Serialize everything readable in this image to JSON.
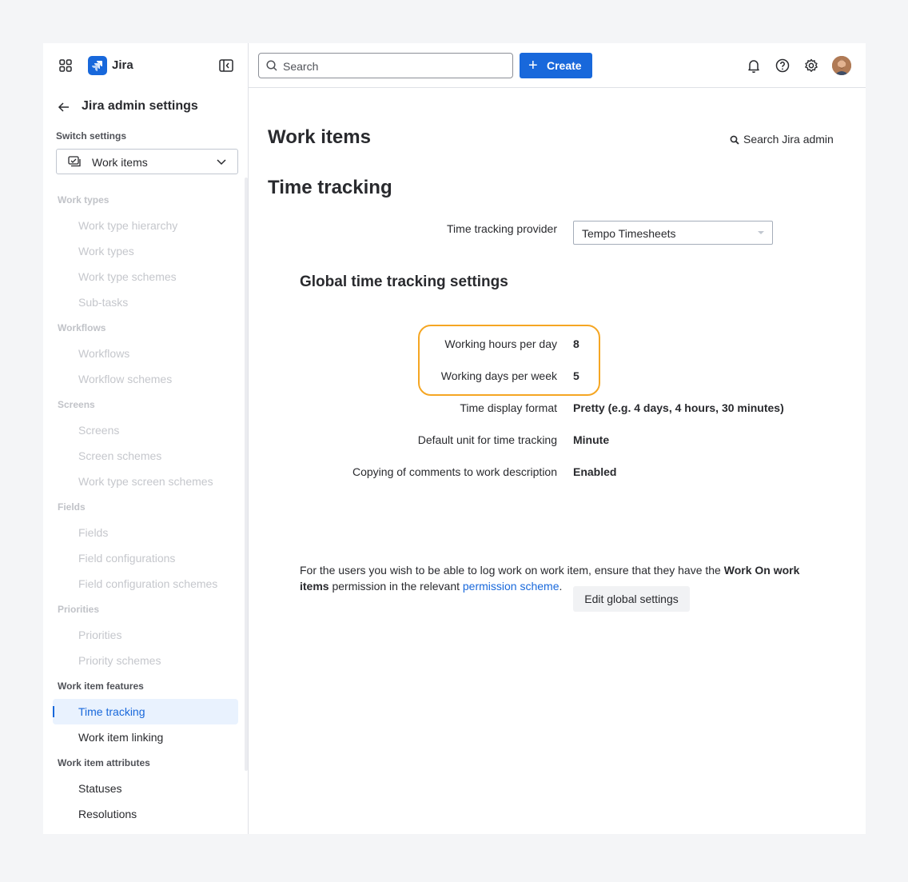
{
  "brand": {
    "app_name": "Jira",
    "logo_color": "#1868db"
  },
  "sidebar": {
    "back_title": "Jira admin settings",
    "switch_label": "Switch settings",
    "switch_value": "Work items",
    "groups": {
      "work_types": "Work types",
      "workflows": "Workflows",
      "screens": "Screens",
      "fields": "Fields",
      "priorities": "Priorities",
      "features": "Work item features",
      "attributes": "Work item attributes"
    },
    "items": {
      "work_type_hierarchy": "Work type hierarchy",
      "work_types": "Work types",
      "work_type_schemes": "Work type schemes",
      "sub_tasks": "Sub-tasks",
      "workflows": "Workflows",
      "workflow_schemes": "Workflow schemes",
      "screens": "Screens",
      "screen_schemes": "Screen schemes",
      "work_type_screen_schemes": "Work type screen schemes",
      "fields": "Fields",
      "field_configurations": "Field configurations",
      "field_configuration_schemes": "Field configuration schemes",
      "priorities": "Priorities",
      "priority_schemes": "Priority schemes",
      "time_tracking": "Time tracking",
      "work_item_linking": "Work item linking",
      "statuses": "Statuses",
      "resolutions": "Resolutions"
    },
    "active_item": "Time tracking"
  },
  "topbar": {
    "search_placeholder": "Search",
    "create_label": "Create",
    "accent_color": "#1868db"
  },
  "main": {
    "page_title": "Work items",
    "search_admin_label": "Search Jira admin",
    "section_title": "Time tracking",
    "provider_label": "Time tracking provider",
    "provider_value": "Tempo Timesheets",
    "global_title": "Global time tracking settings",
    "settings": [
      {
        "label": "Working hours per day",
        "value": "8"
      },
      {
        "label": "Working days per week",
        "value": "5"
      },
      {
        "label": "Time display format",
        "value": "Pretty (e.g. 4 days, 4 hours, 30 minutes)"
      },
      {
        "label": "Default unit for time tracking",
        "value": "Minute"
      },
      {
        "label": "Copying of comments to work description",
        "value": "Enabled"
      }
    ],
    "info": {
      "part1": "For the users you wish to be able to log work on work item, ensure that they have the ",
      "bold": "Work On work items",
      "part2": " permission in the relevant ",
      "link": "permission scheme",
      "part3": "."
    },
    "edit_button": "Edit global settings",
    "highlight_color": "#f5a623"
  }
}
